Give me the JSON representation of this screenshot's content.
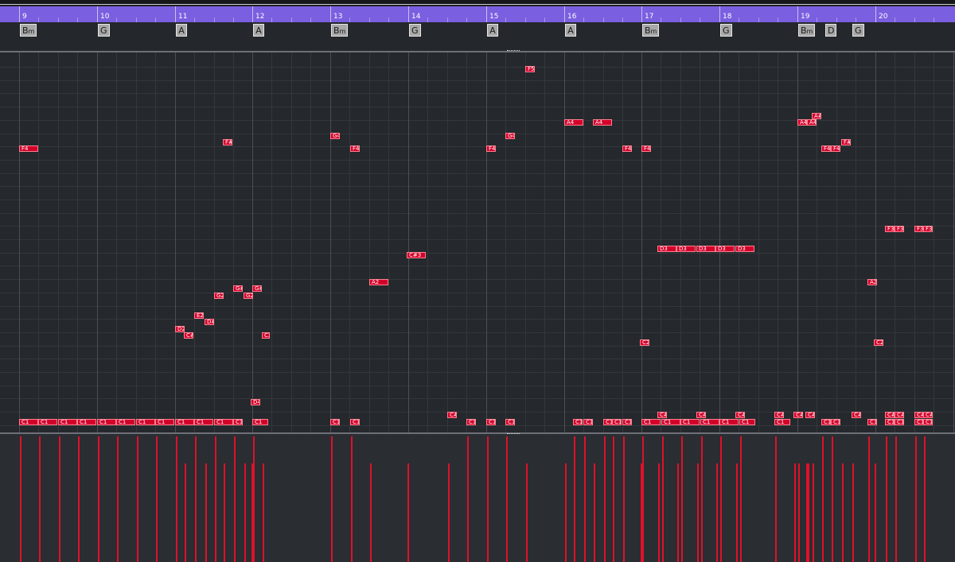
{
  "ruler": {
    "bars": [
      "9",
      "10",
      "11",
      "12",
      "13",
      "14",
      "15",
      "16",
      "17",
      "18",
      "19",
      "20"
    ]
  },
  "chords": [
    {
      "root": "B",
      "suffix": "m"
    },
    {
      "root": "G",
      "suffix": ""
    },
    {
      "root": "A",
      "suffix": ""
    },
    {
      "root": "A",
      "suffix": ""
    },
    {
      "root": "B",
      "suffix": "m"
    },
    {
      "root": "G",
      "suffix": ""
    },
    {
      "root": "A",
      "suffix": ""
    },
    {
      "root": "A",
      "suffix": ""
    },
    {
      "root": "B",
      "suffix": "m"
    },
    {
      "root": "G",
      "suffix": ""
    },
    {
      "root": "B",
      "suffix": "m"
    },
    {
      "root": "D",
      "suffix": ""
    },
    {
      "root": "G",
      "suffix": ""
    }
  ],
  "notes": [
    {
      "label": "F5",
      "bar": 15.5,
      "len": 0.12
    },
    {
      "label": "A4",
      "bar": 16.0,
      "len": 0.25
    },
    {
      "label": "A4",
      "bar": 16.37,
      "len": 0.25
    },
    {
      "label": "A4",
      "bar": 19.0,
      "len": 0.12
    },
    {
      "label": "A4",
      "bar": 19.12,
      "len": 0.12
    },
    {
      "label": "A#",
      "bar": 19.18,
      "len": 0.12
    },
    {
      "label": "G4",
      "bar": 13.0,
      "len": 0.12
    },
    {
      "label": "G4",
      "bar": 15.25,
      "len": 0.12
    },
    {
      "label": "F4",
      "bar": 9.0,
      "len": 0.25
    },
    {
      "label": "F4",
      "bar": 13.25,
      "len": 0.12
    },
    {
      "label": "F4",
      "bar": 15.0,
      "len": 0.12
    },
    {
      "label": "F4",
      "bar": 16.75,
      "len": 0.12
    },
    {
      "label": "F4",
      "bar": 17.0,
      "len": 0.12
    },
    {
      "label": "F4",
      "bar": 19.31,
      "len": 0.12
    },
    {
      "label": "F4",
      "bar": 19.43,
      "len": 0.12
    },
    {
      "label": "F#",
      "bar": 19.56,
      "len": 0.12
    },
    {
      "label": "F3",
      "bar": 20.12,
      "len": 0.12
    },
    {
      "label": "F3",
      "bar": 20.25,
      "len": 0.12
    },
    {
      "label": "F3",
      "bar": 20.5,
      "len": 0.12
    },
    {
      "label": "F3",
      "bar": 20.62,
      "len": 0.12
    },
    {
      "label": "D3",
      "bar": 17.2,
      "len": 0.25
    },
    {
      "label": "D3",
      "bar": 17.45,
      "len": 0.25
    },
    {
      "label": "D3",
      "bar": 17.7,
      "len": 0.25
    },
    {
      "label": "D3",
      "bar": 17.95,
      "len": 0.25
    },
    {
      "label": "D3",
      "bar": 18.2,
      "len": 0.25
    },
    {
      "label": "C#3",
      "bar": 13.98,
      "len": 0.25
    },
    {
      "label": "A2",
      "bar": 13.5,
      "len": 0.25
    },
    {
      "label": "A2",
      "bar": 19.9,
      "len": 0.12
    },
    {
      "label": "G#",
      "bar": 11.75,
      "len": 0.12
    },
    {
      "label": "G#",
      "bar": 12.0,
      "len": 0.12
    },
    {
      "label": "G2",
      "bar": 11.5,
      "len": 0.12
    },
    {
      "label": "G2",
      "bar": 11.88,
      "len": 0.12
    },
    {
      "label": "F#",
      "bar": 11.62,
      "len": 0.12
    },
    {
      "label": "E2",
      "bar": 11.25,
      "len": 0.12
    },
    {
      "label": "D#",
      "bar": 11.38,
      "len": 0.12
    },
    {
      "label": "D2",
      "bar": 11.0,
      "len": 0.12
    },
    {
      "label": "C#",
      "bar": 11.12,
      "len": 0.12
    },
    {
      "label": "C2",
      "bar": 12.12,
      "len": 0.1
    },
    {
      "label": "C2",
      "bar": 16.98,
      "len": 0.12
    },
    {
      "label": "C2",
      "bar": 19.98,
      "len": 0.12
    },
    {
      "label": "D4",
      "bar": 11.98,
      "len": 0.12
    },
    {
      "label": "C#",
      "bar": 17.2,
      "len": 0.12
    },
    {
      "label": "C#",
      "bar": 17.7,
      "len": 0.12
    },
    {
      "label": "C#",
      "bar": 18.2,
      "len": 0.12
    },
    {
      "label": "C#",
      "bar": 18.7,
      "len": 0.12
    },
    {
      "label": "C#",
      "bar": 18.95,
      "len": 0.12
    },
    {
      "label": "C#",
      "bar": 19.1,
      "len": 0.12
    },
    {
      "label": "C#",
      "bar": 19.7,
      "len": 0.12
    },
    {
      "label": "C#",
      "bar": 20.12,
      "len": 0.12
    },
    {
      "label": "C#",
      "bar": 20.25,
      "len": 0.12
    },
    {
      "label": "C#",
      "bar": 20.5,
      "len": 0.12
    },
    {
      "label": "C#",
      "bar": 20.62,
      "len": 0.12
    },
    {
      "label": "C#",
      "bar": 14.5,
      "len": 0.12
    },
    {
      "label": "C1",
      "bar": 9.0,
      "len": 0.25
    },
    {
      "label": "C1",
      "bar": 9.25,
      "len": 0.25
    },
    {
      "label": "C1",
      "bar": 9.5,
      "len": 0.25
    },
    {
      "label": "C1",
      "bar": 9.75,
      "len": 0.25
    },
    {
      "label": "C1",
      "bar": 10.0,
      "len": 0.25
    },
    {
      "label": "C1",
      "bar": 10.25,
      "len": 0.25
    },
    {
      "label": "C1",
      "bar": 10.5,
      "len": 0.25
    },
    {
      "label": "C1",
      "bar": 10.75,
      "len": 0.25
    },
    {
      "label": "C1",
      "bar": 11.0,
      "len": 0.25
    },
    {
      "label": "C1",
      "bar": 11.25,
      "len": 0.25
    },
    {
      "label": "C1",
      "bar": 11.5,
      "len": 0.25
    },
    {
      "label": "C1",
      "bar": 11.75,
      "len": 0.12
    },
    {
      "label": "C1",
      "bar": 12.0,
      "len": 0.2
    },
    {
      "label": "C1",
      "bar": 13.0,
      "len": 0.12
    },
    {
      "label": "C1",
      "bar": 13.25,
      "len": 0.12
    },
    {
      "label": "C1",
      "bar": 14.75,
      "len": 0.12
    },
    {
      "label": "C1",
      "bar": 15.0,
      "len": 0.12
    },
    {
      "label": "C1",
      "bar": 15.25,
      "len": 0.12
    },
    {
      "label": "C1",
      "bar": 16.12,
      "len": 0.12
    },
    {
      "label": "C1",
      "bar": 16.25,
      "len": 0.12
    },
    {
      "label": "C1",
      "bar": 16.5,
      "len": 0.12
    },
    {
      "label": "C1",
      "bar": 16.62,
      "len": 0.12
    },
    {
      "label": "C1",
      "bar": 16.75,
      "len": 0.12
    },
    {
      "label": "C1",
      "bar": 17.0,
      "len": 0.25
    },
    {
      "label": "C1",
      "bar": 17.25,
      "len": 0.25
    },
    {
      "label": "C1",
      "bar": 17.5,
      "len": 0.25
    },
    {
      "label": "C1",
      "bar": 17.75,
      "len": 0.25
    },
    {
      "label": "C1",
      "bar": 18.0,
      "len": 0.25
    },
    {
      "label": "C1",
      "bar": 18.25,
      "len": 0.2
    },
    {
      "label": "C1",
      "bar": 18.7,
      "len": 0.2
    },
    {
      "label": "C1",
      "bar": 19.31,
      "len": 0.12
    },
    {
      "label": "C1",
      "bar": 19.43,
      "len": 0.12
    },
    {
      "label": "C1",
      "bar": 19.9,
      "len": 0.12
    },
    {
      "label": "C1",
      "bar": 20.12,
      "len": 0.12
    },
    {
      "label": "C1",
      "bar": 20.25,
      "len": 0.12
    },
    {
      "label": "C1",
      "bar": 20.5,
      "len": 0.12
    },
    {
      "label": "C1",
      "bar": 20.62,
      "len": 0.12
    }
  ]
}
